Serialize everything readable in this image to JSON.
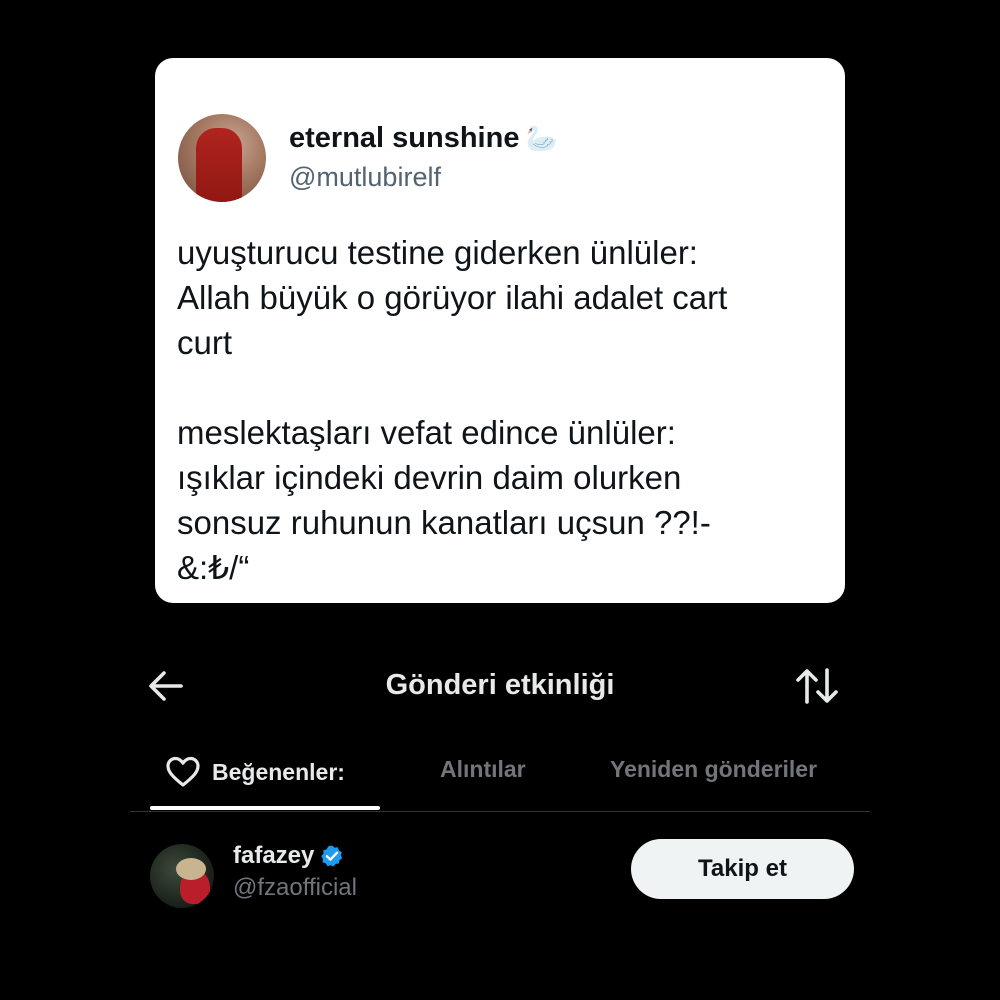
{
  "tweet": {
    "display_name": "eternal sunshine",
    "name_emoji": "🦢",
    "handle": "@mutlubirelf",
    "text": "uyuşturucu testine giderken ünlüler:\nAllah büyük o görüyor ilahi adalet cart\ncurt\n\nmeslektaşları vefat edince ünlüler:\nışıklar içindeki devrin daim olurken\nsonsuz ruhunun kanatları uçsun ??!-\n&:₺/“"
  },
  "header": {
    "title": "Gönderi etkinliği",
    "back_icon": "arrow-left-icon",
    "sort_icon": "sort-arrows-icon"
  },
  "tabs": [
    {
      "label": "Beğenenler:",
      "icon": "heart-icon",
      "active": true
    },
    {
      "label": "Alıntılar",
      "active": false
    },
    {
      "label": "Yeniden gönderiler",
      "active": false
    }
  ],
  "user": {
    "name": "fafazey",
    "verified": true,
    "handle": "@fzaofficial",
    "follow_label": "Takip et"
  },
  "colors": {
    "background": "#000000",
    "card": "#ffffff",
    "verified": "#1d9bf0",
    "muted": "#71767b",
    "follow_button": "#eff3f4"
  }
}
